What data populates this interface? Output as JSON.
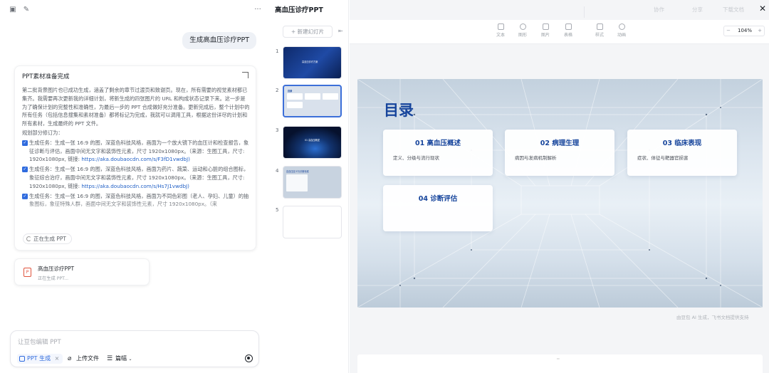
{
  "chat": {
    "user_message": "生成高血压诊疗PPT",
    "status_card": {
      "title": "PPT素材准备完成",
      "paragraph": "第二批背景图片也已成功生成，涵盖了剩余的章节过渡页和致谢页。现在，所有需要的视觉素材都已集齐。我需要再次更新我的详细计划，将新生成的四张图片的 URL 和构成状态记录下来。这一步是为了确保计划的完整性和准确性，为最后一步的 PPT 合成做好充分准备。更新完成后，整个计划中的所有任务（包括信息搜集和素材准备）都将标记为完成，我就可以调用工具，根据这份详尽的计划和所有素材，生成最终的 PPT 文件。",
      "plan_label": "规划部分修订为：",
      "tasks": [
        {
          "text": "生成任务：生成一张 16:9 的图，深蓝色科技风格，画面为一个放大镜下的血压计和检查报告，象征诊断与评估，画面中间无文字和装饰性元素，尺寸 1920x1080px。（来源：生图工具，尺寸: 1920x1080px, 链接: ",
          "link": "https://aka.doubaocdn.com/s/F3fD1vwdbJ)"
        },
        {
          "text": "生成任务：生成一张 16:9 的图，深蓝色科技风格，画面为药片、蔬菜、运动和心脏的组合图标，象征综合治疗，画面中间无文字和装饰性元素，尺寸 1920x1080px。（来源：生图工具，尺寸: 1920x1080px, 链接: ",
          "link": "https://aka.doubaocdn.com/s/Hs7J1vwdbJ)"
        },
        {
          "text": "生成任务：生成一张 16:9 的图，深蓝色科技风格，画面为不同色彩图（老人、孕妇、儿童）的抽象图标，象征特殊人群，画面中间无文字和装饰性元素，尺寸 1920x1080px。（来",
          "link": ""
        }
      ],
      "generating_label": "正在生成 PPT"
    },
    "file_card": {
      "name": "高血压诊疗PPT",
      "status": "正在生成 PPT..."
    },
    "input": {
      "placeholder": "让豆包编辑 PPT",
      "ppt_chip": "PPT 生成",
      "chip_close": "×",
      "upload": "上传文件",
      "aspect": "篇幅"
    }
  },
  "slides_panel": {
    "doc_title": "高血压诊疗PPT",
    "new_slide": "+ 新建幻灯片",
    "thumbs": [
      {
        "num": "1",
        "mini_title": "高血压诊疗方案"
      },
      {
        "num": "2",
        "mini_title": "目录"
      },
      {
        "num": "3",
        "mini_title": "01 高血压概述"
      },
      {
        "num": "4",
        "mini_title": "高血压定义与诊断标准"
      },
      {
        "num": "5",
        "mini_title": ""
      }
    ]
  },
  "editor": {
    "top_actions": [
      "协作",
      "分享",
      "下载文档"
    ],
    "toolbar": [
      {
        "label": "文本",
        "icon": "text-icon"
      },
      {
        "label": "图形",
        "icon": "shape-icon"
      },
      {
        "label": "图片",
        "icon": "image-icon"
      },
      {
        "label": "表格",
        "icon": "table-icon"
      },
      {
        "label": "样式",
        "icon": "style-icon"
      },
      {
        "label": "动画",
        "icon": "animation-icon"
      }
    ],
    "zoom": {
      "minus": "−",
      "value": "104%",
      "plus": "+"
    },
    "slide": {
      "heading": "目录",
      "cards": [
        {
          "title": "01 高血压概述",
          "desc": "定义、分级与流行现状"
        },
        {
          "title": "02 病理生理",
          "desc": "病因与发病机制解析"
        },
        {
          "title": "03 临床表现",
          "desc": "症状、体征与靶器官损害"
        },
        {
          "title": "04 诊断评估",
          "desc": ""
        }
      ]
    },
    "footnote": "由豆包 AI 生成，飞书文档提供支持"
  },
  "colors": {
    "accent": "#2f6bde",
    "slide_heading": "#17459c"
  }
}
